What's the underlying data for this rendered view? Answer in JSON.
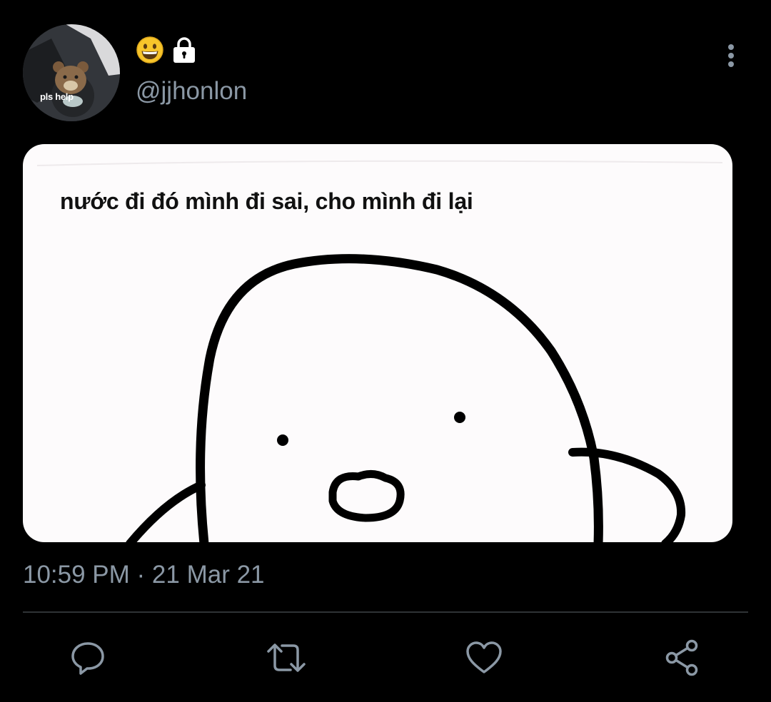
{
  "tweet": {
    "avatar_caption": "pls help",
    "display_name_emoji": "😀",
    "handle": "@jjhonlon",
    "image_caption": "nước đi đó mình đi sai, cho mình đi lại",
    "timestamp": "10:59 PM · 21 Mar 21"
  },
  "icons": {
    "more": "more-vertical-icon",
    "reply": "reply-bubble-icon",
    "retweet": "retweet-icon",
    "like": "heart-icon",
    "share": "share-icon",
    "lock": "lock-icon"
  },
  "colors": {
    "background": "#000000",
    "secondary_text": "#8b98a5",
    "divider": "#2f3336",
    "image_background": "#fdfbfc"
  }
}
